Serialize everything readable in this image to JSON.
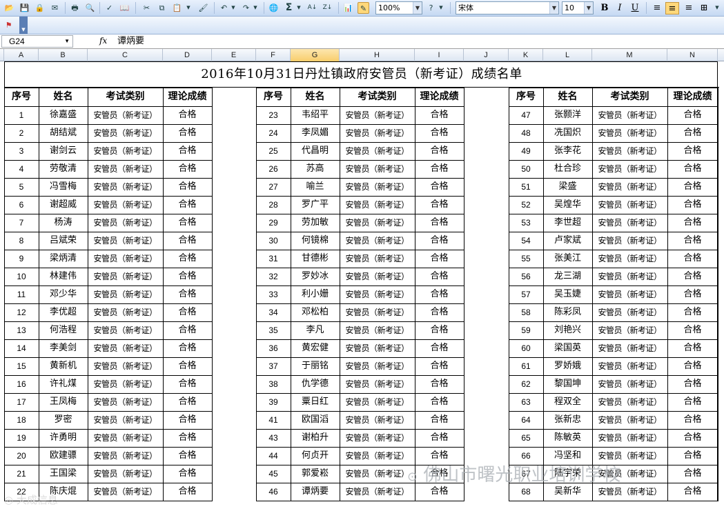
{
  "toolbar": {
    "zoom": "100%",
    "font_name": "宋体",
    "font_size": "10",
    "sigma": "Σ",
    "bold": "B",
    "italic": "I",
    "underline": "U"
  },
  "formula_bar": {
    "name_box": "G24",
    "fx": "fx",
    "content": "谭炳要"
  },
  "columns": [
    "A",
    "B",
    "C",
    "D",
    "E",
    "F",
    "G",
    "H",
    "I",
    "J",
    "K",
    "L",
    "M",
    "N"
  ],
  "selected_column": "G",
  "sheet": {
    "title": "2016年10月31日丹灶镇政府安管员（新考证）成绩名单",
    "headers": [
      "序号",
      "姓名",
      "考试类别",
      "理论成绩"
    ],
    "category": "安管员（新考证）",
    "result": "合格",
    "groups": [
      {
        "rows": [
          [
            "1",
            "徐嘉盛"
          ],
          [
            "2",
            "胡结斌"
          ],
          [
            "3",
            "谢剑云"
          ],
          [
            "4",
            "劳敬清"
          ],
          [
            "5",
            "冯雪梅"
          ],
          [
            "6",
            "谢超威"
          ],
          [
            "7",
            "杨涛"
          ],
          [
            "8",
            "吕斌荣"
          ],
          [
            "9",
            "梁炳清"
          ],
          [
            "10",
            "林建伟"
          ],
          [
            "11",
            "邓少华"
          ],
          [
            "12",
            "李优超"
          ],
          [
            "13",
            "何浩程"
          ],
          [
            "14",
            "李美剑"
          ],
          [
            "15",
            "黄新机"
          ],
          [
            "16",
            "许礼煤"
          ],
          [
            "17",
            "王凤梅"
          ],
          [
            "18",
            "罗密"
          ],
          [
            "19",
            "许勇明"
          ],
          [
            "20",
            "欧建骠"
          ],
          [
            "21",
            "王国梁"
          ],
          [
            "22",
            "陈庆焜"
          ]
        ]
      },
      {
        "rows": [
          [
            "23",
            "韦绍平"
          ],
          [
            "24",
            "李凤媚"
          ],
          [
            "25",
            "代昌明"
          ],
          [
            "26",
            "苏高"
          ],
          [
            "27",
            "喻兰"
          ],
          [
            "28",
            "罗广平"
          ],
          [
            "29",
            "劳加敏"
          ],
          [
            "30",
            "何镜棉"
          ],
          [
            "31",
            "甘德彬"
          ],
          [
            "32",
            "罗妙冰"
          ],
          [
            "33",
            "利小姗"
          ],
          [
            "34",
            "邓松柏"
          ],
          [
            "35",
            "李凡"
          ],
          [
            "36",
            "黄宏健"
          ],
          [
            "37",
            "于丽铭"
          ],
          [
            "38",
            "仇学德"
          ],
          [
            "39",
            "粟日红"
          ],
          [
            "41",
            "欧国滔"
          ],
          [
            "43",
            "谢柏升"
          ],
          [
            "44",
            "何贞开"
          ],
          [
            "45",
            "郭爱崧"
          ],
          [
            "46",
            "谭炳要"
          ]
        ]
      },
      {
        "rows": [
          [
            "47",
            "张颢洋"
          ],
          [
            "48",
            "冼国炽"
          ],
          [
            "49",
            "张李花"
          ],
          [
            "50",
            "杜合珍"
          ],
          [
            "51",
            "梁盛"
          ],
          [
            "52",
            "吴煌华"
          ],
          [
            "53",
            "李世超"
          ],
          [
            "54",
            "卢家斌"
          ],
          [
            "55",
            "张美江"
          ],
          [
            "56",
            "龙三湖"
          ],
          [
            "57",
            "吴玉婕"
          ],
          [
            "58",
            "陈彩凤"
          ],
          [
            "59",
            "刘艳兴"
          ],
          [
            "60",
            "梁国英"
          ],
          [
            "61",
            "罗娇娥"
          ],
          [
            "62",
            "黎国坤"
          ],
          [
            "63",
            "程双全"
          ],
          [
            "64",
            "张新忠"
          ],
          [
            "65",
            "陈敏英"
          ],
          [
            "66",
            "冯坚和"
          ],
          [
            "67",
            "陆宇荣"
          ],
          [
            "68",
            "吴新华"
          ]
        ]
      }
    ]
  },
  "watermark": {
    "main": "佛山市曙光职业培训学校",
    "corner": "大成信息"
  }
}
